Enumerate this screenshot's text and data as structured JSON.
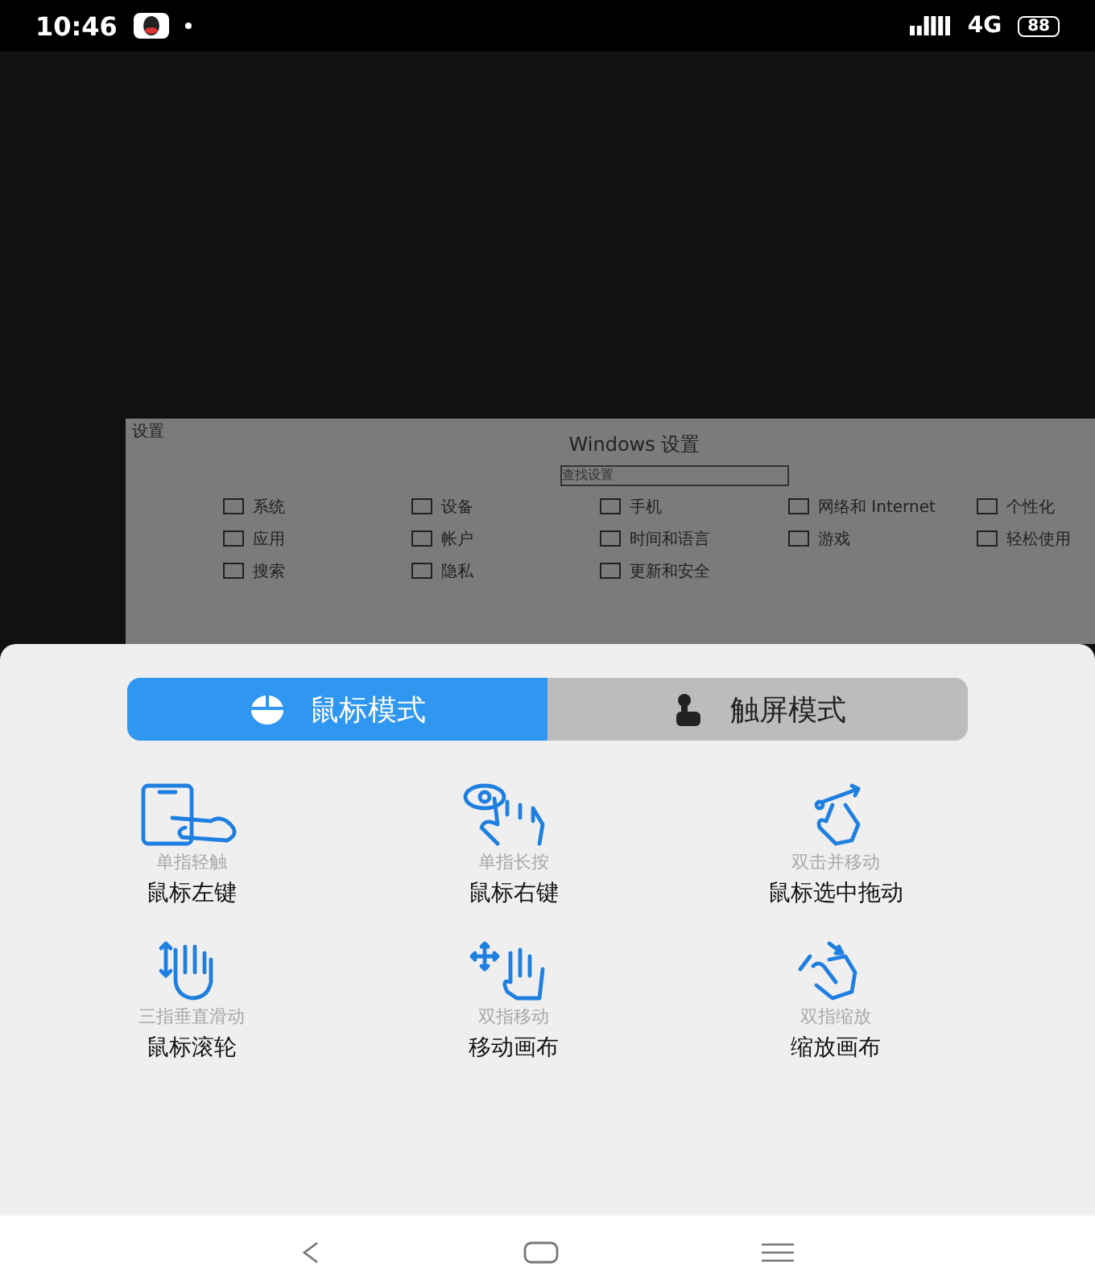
{
  "status_bar": {
    "time": "10:46",
    "network": "4G",
    "battery": "88"
  },
  "remote_screen": {
    "corner_label": "设置",
    "title": "Windows 设置",
    "search": {
      "placeholder": "查找设置"
    },
    "categories": [
      {
        "name": "系统"
      },
      {
        "name": "设备"
      },
      {
        "name": "手机"
      },
      {
        "name": "网络和 Internet"
      },
      {
        "name": "个性化"
      },
      {
        "name": "应用"
      },
      {
        "name": "帐户"
      },
      {
        "name": "时间和语言"
      },
      {
        "name": "游戏"
      },
      {
        "name": "轻松使用"
      },
      {
        "name": "搜索"
      },
      {
        "name": "隐私"
      },
      {
        "name": "更新和安全"
      }
    ]
  },
  "mode_tabs": [
    {
      "label": "鼠标模式",
      "selected": true,
      "kind": "mouse"
    },
    {
      "label": "触屏模式",
      "selected": false,
      "kind": "touch"
    }
  ],
  "gestures": [
    {
      "gesture": "单指轻触",
      "action": "鼠标左键",
      "kind": "tap"
    },
    {
      "gesture": "单指长按",
      "action": "鼠标右键",
      "kind": "press"
    },
    {
      "gesture": "双击并移动",
      "action": "鼠标选中拖动",
      "kind": "drag"
    },
    {
      "gesture": "三指垂直滑动",
      "action": "鼠标滚轮",
      "kind": "scroll"
    },
    {
      "gesture": "双指移动",
      "action": "移动画布",
      "kind": "pan"
    },
    {
      "gesture": "双指缩放",
      "action": "缩放画布",
      "kind": "zoom"
    }
  ]
}
